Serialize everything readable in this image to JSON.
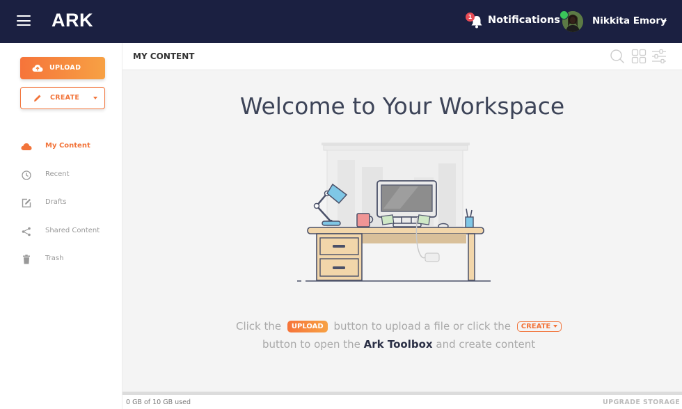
{
  "app": {
    "logo": "ARK"
  },
  "header": {
    "notifications_label": "Notifications",
    "notifications_count": "1",
    "user_name": "Nikkita Emory"
  },
  "sidebar": {
    "upload_label": "UPLOAD",
    "create_label": "CREATE",
    "items": [
      {
        "label": "My Content",
        "icon": "cloud-icon",
        "active": true
      },
      {
        "label": "Recent",
        "icon": "clock-icon",
        "active": false
      },
      {
        "label": "Drafts",
        "icon": "edit-icon",
        "active": false
      },
      {
        "label": "Shared Content",
        "icon": "share-icon",
        "active": false
      },
      {
        "label": "Trash",
        "icon": "trash-icon",
        "active": false
      }
    ]
  },
  "content": {
    "title": "MY CONTENT",
    "welcome": "Welcome to Your Workspace",
    "hint": {
      "part1": "Click the",
      "upload_pill": "UPLOAD",
      "part2": "button to upload a file or click the",
      "create_pill": "CREATE",
      "part3": "button to open the",
      "toolbox": "Ark Toolbox",
      "part4": "and create content"
    }
  },
  "footer": {
    "storage_used": "0 GB of 10 GB used",
    "upgrade_label": "UPGRADE STORAGE"
  },
  "colors": {
    "topbar": "#1b2041",
    "accent": "#f2743a",
    "accent_light": "#f7a144"
  }
}
